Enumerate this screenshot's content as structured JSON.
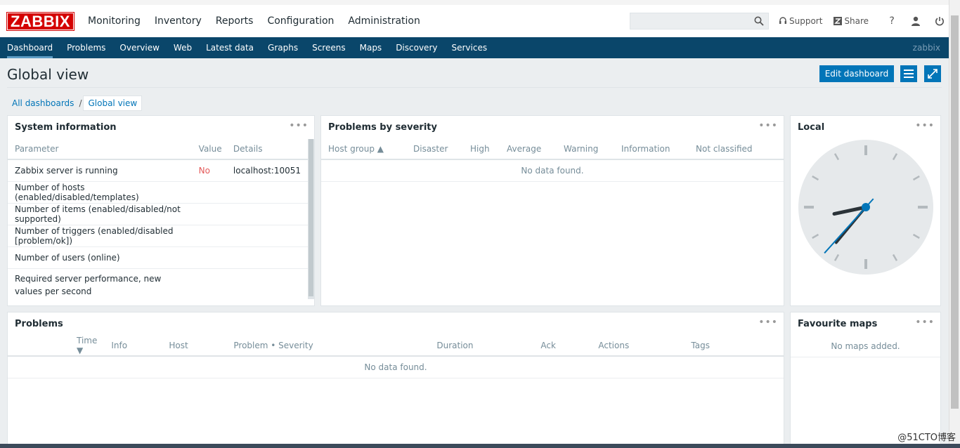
{
  "logo": "ZABBIX",
  "main_nav": [
    "Monitoring",
    "Inventory",
    "Reports",
    "Configuration",
    "Administration"
  ],
  "search": {
    "value": "",
    "placeholder": ""
  },
  "top_links": {
    "support": "Support",
    "share": "Share",
    "help": "?"
  },
  "sub_nav": [
    "Dashboard",
    "Problems",
    "Overview",
    "Web",
    "Latest data",
    "Graphs",
    "Screens",
    "Maps",
    "Discovery",
    "Services"
  ],
  "user": "zabbix",
  "page_title": "Global view",
  "edit_dashboard": "Edit dashboard",
  "breadcrumb": {
    "all": "All dashboards",
    "sep": "/",
    "current": "Global view"
  },
  "system_info": {
    "title": "System information",
    "headers": [
      "Parameter",
      "Value",
      "Details"
    ],
    "rows": [
      {
        "param": "Zabbix server is running",
        "value": "No",
        "details": "localhost:10051"
      },
      {
        "param": "Number of hosts (enabled/disabled/templates)",
        "value": "",
        "details": ""
      },
      {
        "param": "Number of items (enabled/disabled/not supported)",
        "value": "",
        "details": ""
      },
      {
        "param": "Number of triggers (enabled/disabled [problem/ok])",
        "value": "",
        "details": ""
      },
      {
        "param": "Number of users (online)",
        "value": "",
        "details": ""
      },
      {
        "param": "Required server performance, new values per second",
        "value": "",
        "details": ""
      }
    ]
  },
  "severity": {
    "title": "Problems by severity",
    "headers": [
      "Host group ▲",
      "Disaster",
      "High",
      "Average",
      "Warning",
      "Information",
      "Not classified"
    ],
    "empty": "No data found."
  },
  "clock": {
    "title": "Local",
    "hour": 8,
    "minute": 36,
    "second": 37,
    "color_hand": "#0275b8"
  },
  "problems": {
    "title": "Problems",
    "headers": [
      "Time ▼",
      "Info",
      "Host",
      "Problem • Severity",
      "Duration",
      "Ack",
      "Actions",
      "Tags"
    ],
    "empty": "No data found."
  },
  "fav_maps": {
    "title": "Favourite maps",
    "empty": "No maps added."
  },
  "watermark": "@51CTO博客",
  "colors": {
    "brand_red": "#d40000",
    "nav_blue": "#0a466a",
    "button_blue": "#0275b8"
  }
}
